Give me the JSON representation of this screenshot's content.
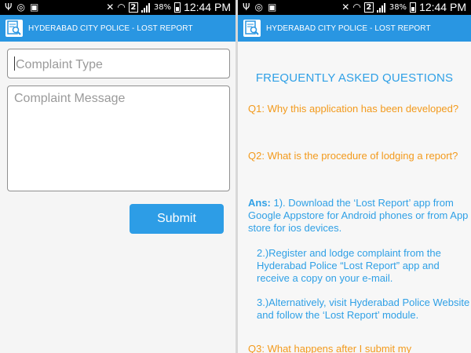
{
  "status_bar": {
    "battery_percent": "38%",
    "sim_badge": "2",
    "time": "12:44 PM"
  },
  "app_bar": {
    "title": "HYDERABAD CITY POLICE - LOST REPORT"
  },
  "form": {
    "complaint_type_placeholder": "Complaint Type",
    "complaint_message_placeholder": "Complaint Message",
    "submit_label": "Submit"
  },
  "faq": {
    "heading": "FREQUENTLY ASKED QUESTIONS",
    "q1": "Q1: Why this application has been developed?",
    "q2": "Q2: What is the procedure of lodging a report?",
    "ans_label": "Ans:",
    "ans_1": " 1). Download the ‘Lost Report’ app from Google Appstore for Android phones or from App store for ios devices.",
    "ans_2": "2.)Register and lodge complaint from the Hyderabad Police “Lost Report” app and receive a copy on your e-mail.",
    "ans_3": "3.)Alternatively, visit Hyderabad Police Website and follow the ‘Lost Report’ module.",
    "q3": "Q3: What happens after I submit my"
  },
  "icons": {
    "usb": "usb-icon",
    "whatsapp": "whatsapp-icon",
    "gallery": "gallery-icon",
    "mute": "mute-icon",
    "wifi": "wifi-icon",
    "signal": "signal-icon",
    "battery": "battery-icon",
    "app_logo": "report-search-icon"
  },
  "colors": {
    "app_bar": "#2996e2",
    "button": "#2d9de6",
    "question": "#f39a1c",
    "answer": "#2fa0e6"
  }
}
